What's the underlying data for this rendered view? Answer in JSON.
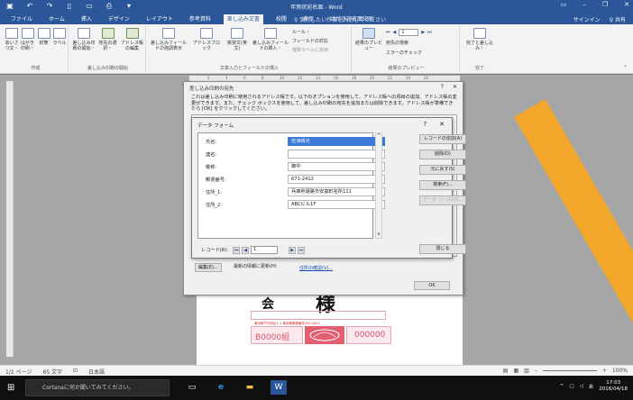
{
  "window": {
    "title": "年賀状宛名面 - Word",
    "qat_icons": [
      "save-icon",
      "undo-icon",
      "redo-icon",
      "new-icon",
      "open-icon",
      "print-preview-icon",
      "customize-icon"
    ],
    "controls": [
      "▭",
      "–",
      "❐",
      "✕"
    ]
  },
  "ribbon": {
    "tabs": [
      "ファイル",
      "ホーム",
      "挿入",
      "デザイン",
      "レイアウト",
      "参考資料",
      "差し込み文書",
      "校閲",
      "表示",
      "はがき宛名面印刷"
    ],
    "active_tab": "差し込み文書",
    "tell_me": "♀ 実行したい作業を入力してください",
    "signin": "サインイン",
    "share": "♀ 共有",
    "groups": {
      "create": {
        "label": "作成",
        "buttons": [
          "あいさつ文・",
          "はがき印刷・",
          "封筒",
          "ラベル"
        ]
      },
      "start_merge": {
        "label": "差し込み印刷の開始",
        "buttons": [
          "差し込み印刷の開始・",
          "宛先の選択・",
          "アドレス帳の編集"
        ]
      },
      "write_insert": {
        "label": "文章入力とフィールドの挿入",
        "buttons": [
          "差し込みフィールドの強調表示",
          "アドレスブロック",
          "挨拶文(英文)",
          "差し込みフィールドの挿入・"
        ],
        "small": [
          "ルール・",
          "フィールドの対応",
          "複数ラベルに反映"
        ]
      },
      "preview": {
        "label": "結果のプレビュー",
        "buttons": [
          "結果のプレビュー"
        ],
        "record": "1",
        "small": [
          "宛先の検索",
          "エラーのチェック"
        ]
      },
      "finish": {
        "label": "完了",
        "buttons": [
          "完了と差し込み・"
        ]
      }
    }
  },
  "ruler": {
    "marks": [
      "2",
      "4",
      "6",
      "8",
      "10",
      "12",
      "14",
      "16",
      "18",
      "20",
      "22",
      "24",
      "26"
    ]
  },
  "outer_dialog": {
    "title": "差し込み印刷の宛先",
    "description": "これは差し込み印刷に使用されるアドレス帳です。以下のオプションを使用して、アドレス帳への項目の追加、アドレス帳の変更ができます。また、チェック ボックスを使用して、差し込み印刷の宛先を追加または削除できます。アドレス帳が準備できたら [OK] をクリックしてください。",
    "edit_button": "編集(E)...",
    "refresh_button": "最新の情報に更新(H)",
    "verify_link": "住所の確認(V)...",
    "ok_button": "OK"
  },
  "data_form": {
    "title": "データ フォーム",
    "fields": [
      {
        "label": "氏名:",
        "value": "伍洲晴光"
      },
      {
        "label": "連名:",
        "value": ""
      },
      {
        "label": "敬称:",
        "value": "御中"
      },
      {
        "label": "郵便番号:",
        "value": "671-2412"
      },
      {
        "label": "住所_1:",
        "value": "兵庫県姫路市安富町名所111"
      },
      {
        "label": "住所_2:",
        "value": "ABCビル1F"
      }
    ],
    "buttons": [
      "レコードの追加(A)",
      "削除(D)",
      "元に戻す(S)",
      "検索(F)...",
      "データ ソース(O)..."
    ],
    "record_label": "レコード(R):",
    "record_value": "1",
    "close_button": "閉じる"
  },
  "document": {
    "honorific_large": "様",
    "mark": "会",
    "sender_code": "B0000組",
    "postcode_stamp": "000000",
    "red_small_text": "東京都千代田区1-1 東京都郵便番号100-0001"
  },
  "status": {
    "page": "1/1 ページ",
    "words": "65 文字",
    "language": "日本語",
    "zoom": "100%"
  },
  "taskbar": {
    "search_placeholder": "Cortanaに何か聞いてみてください。",
    "time": "17:03",
    "date": "2016/04/18",
    "ime": "あ"
  }
}
